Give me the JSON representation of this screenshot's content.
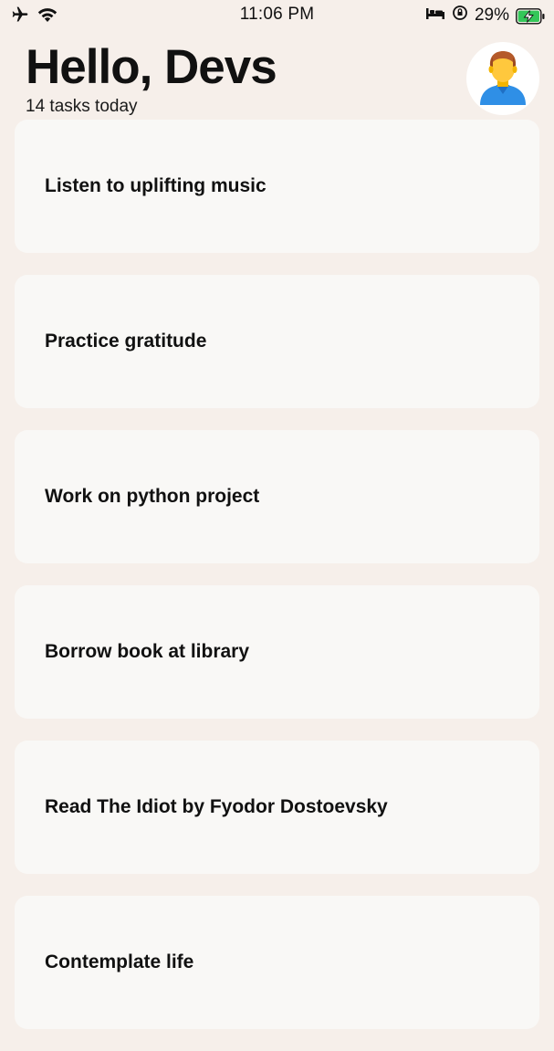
{
  "status_bar": {
    "time": "11:06 PM",
    "battery_percent": "29%",
    "left_icons": [
      "airplane-icon",
      "wifi-icon"
    ],
    "right_icons": [
      "bed-icon",
      "orientation-lock-icon",
      "battery-charging-icon"
    ]
  },
  "header": {
    "greeting": "Hello, Devs",
    "subtitle": "14 tasks today"
  },
  "avatar": {
    "icon": "person-avatar-icon"
  },
  "tasks": [
    {
      "title": "Listen to uplifting music"
    },
    {
      "title": "Practice gratitude"
    },
    {
      "title": "Work on python project"
    },
    {
      "title": "Borrow book at library"
    },
    {
      "title": "Read The Idiot by Fyodor Dostoevsky"
    },
    {
      "title": "Contemplate life"
    }
  ],
  "colors": {
    "background": "#f6efea",
    "card": "#f9f8f6",
    "text": "#111111",
    "battery_charge": "#34c759"
  }
}
